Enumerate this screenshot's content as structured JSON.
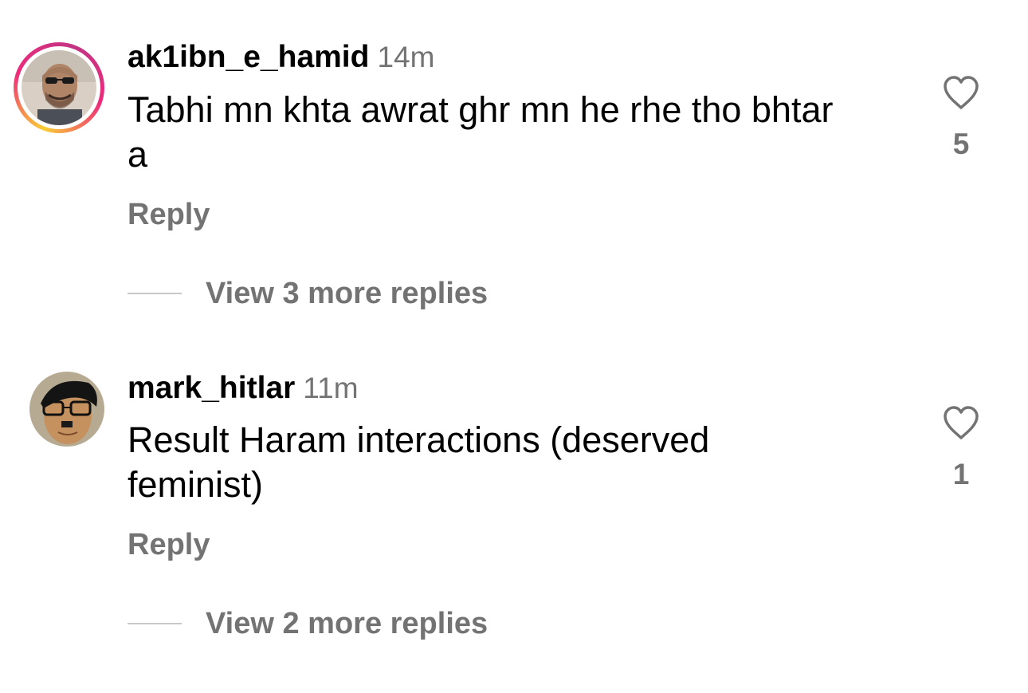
{
  "comments": [
    {
      "username": "ak1ibn_e_hamid",
      "time": "14m",
      "text": "Tabhi mn khta awrat ghr mn he rhe tho bhtar a",
      "reply_label": "Reply",
      "view_more_label": "View 3 more replies",
      "like_count": "5",
      "has_story_ring": true
    },
    {
      "username": "mark_hitlar",
      "time": "11m",
      "text": "Result Haram interactions (deserved feminist)",
      "reply_label": "Reply",
      "view_more_label": "View 2 more replies",
      "like_count": "1",
      "has_story_ring": false
    }
  ],
  "colors": {
    "secondary_text": "#737373",
    "primary_text": "#000000",
    "divider": "#c7c7c7",
    "story_ring": [
      "#f9ce34",
      "#ee2a7b",
      "#c13584"
    ]
  }
}
